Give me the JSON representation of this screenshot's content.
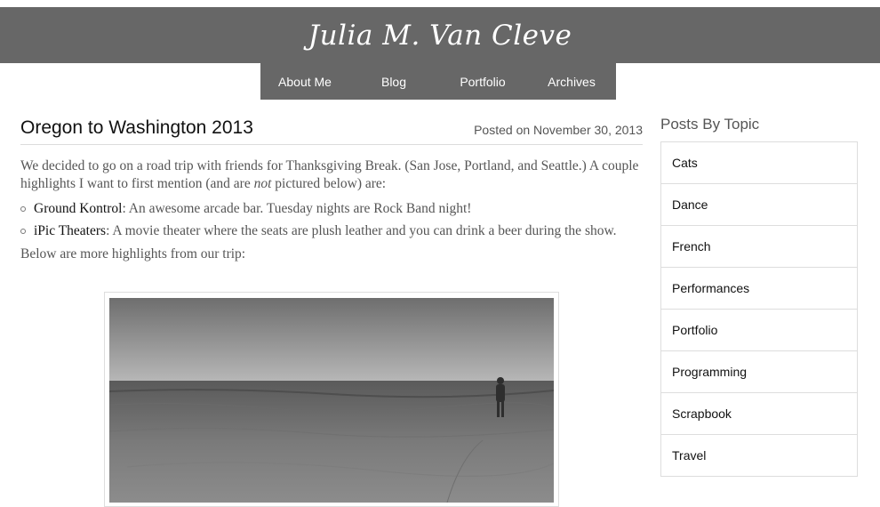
{
  "site": {
    "title": "Julia M. Van Cleve"
  },
  "nav": {
    "items": [
      "About Me",
      "Blog",
      "Portfolio",
      "Archives"
    ]
  },
  "post": {
    "title": "Oregon to Washington 2013",
    "date": "Posted on November 30, 2013",
    "intro_before": "We decided to go on a road trip with friends for Thanksgiving Break. (San Jose, Portland, and Seattle.) A couple highlights I want to first mention (and are ",
    "intro_em": "not",
    "intro_after": " pictured below) are:",
    "highlights": [
      {
        "name": "Ground Kontrol",
        "desc": ": An awesome arcade bar. Tuesday nights are Rock Band night!"
      },
      {
        "name": "iPic Theaters",
        "desc": ": A movie theater where the seats are plush leather and you can drink a beer during the show."
      }
    ],
    "outro": "Below are more highlights from our trip:"
  },
  "sidebar": {
    "heading": "Posts By Topic",
    "topics": [
      "Cats",
      "Dance",
      "French",
      "Performances",
      "Portfolio",
      "Programming",
      "Scrapbook",
      "Travel"
    ]
  },
  "colors": {
    "header_bg": "#676767",
    "header_text": "#ffffff",
    "border": "#dddddd"
  }
}
